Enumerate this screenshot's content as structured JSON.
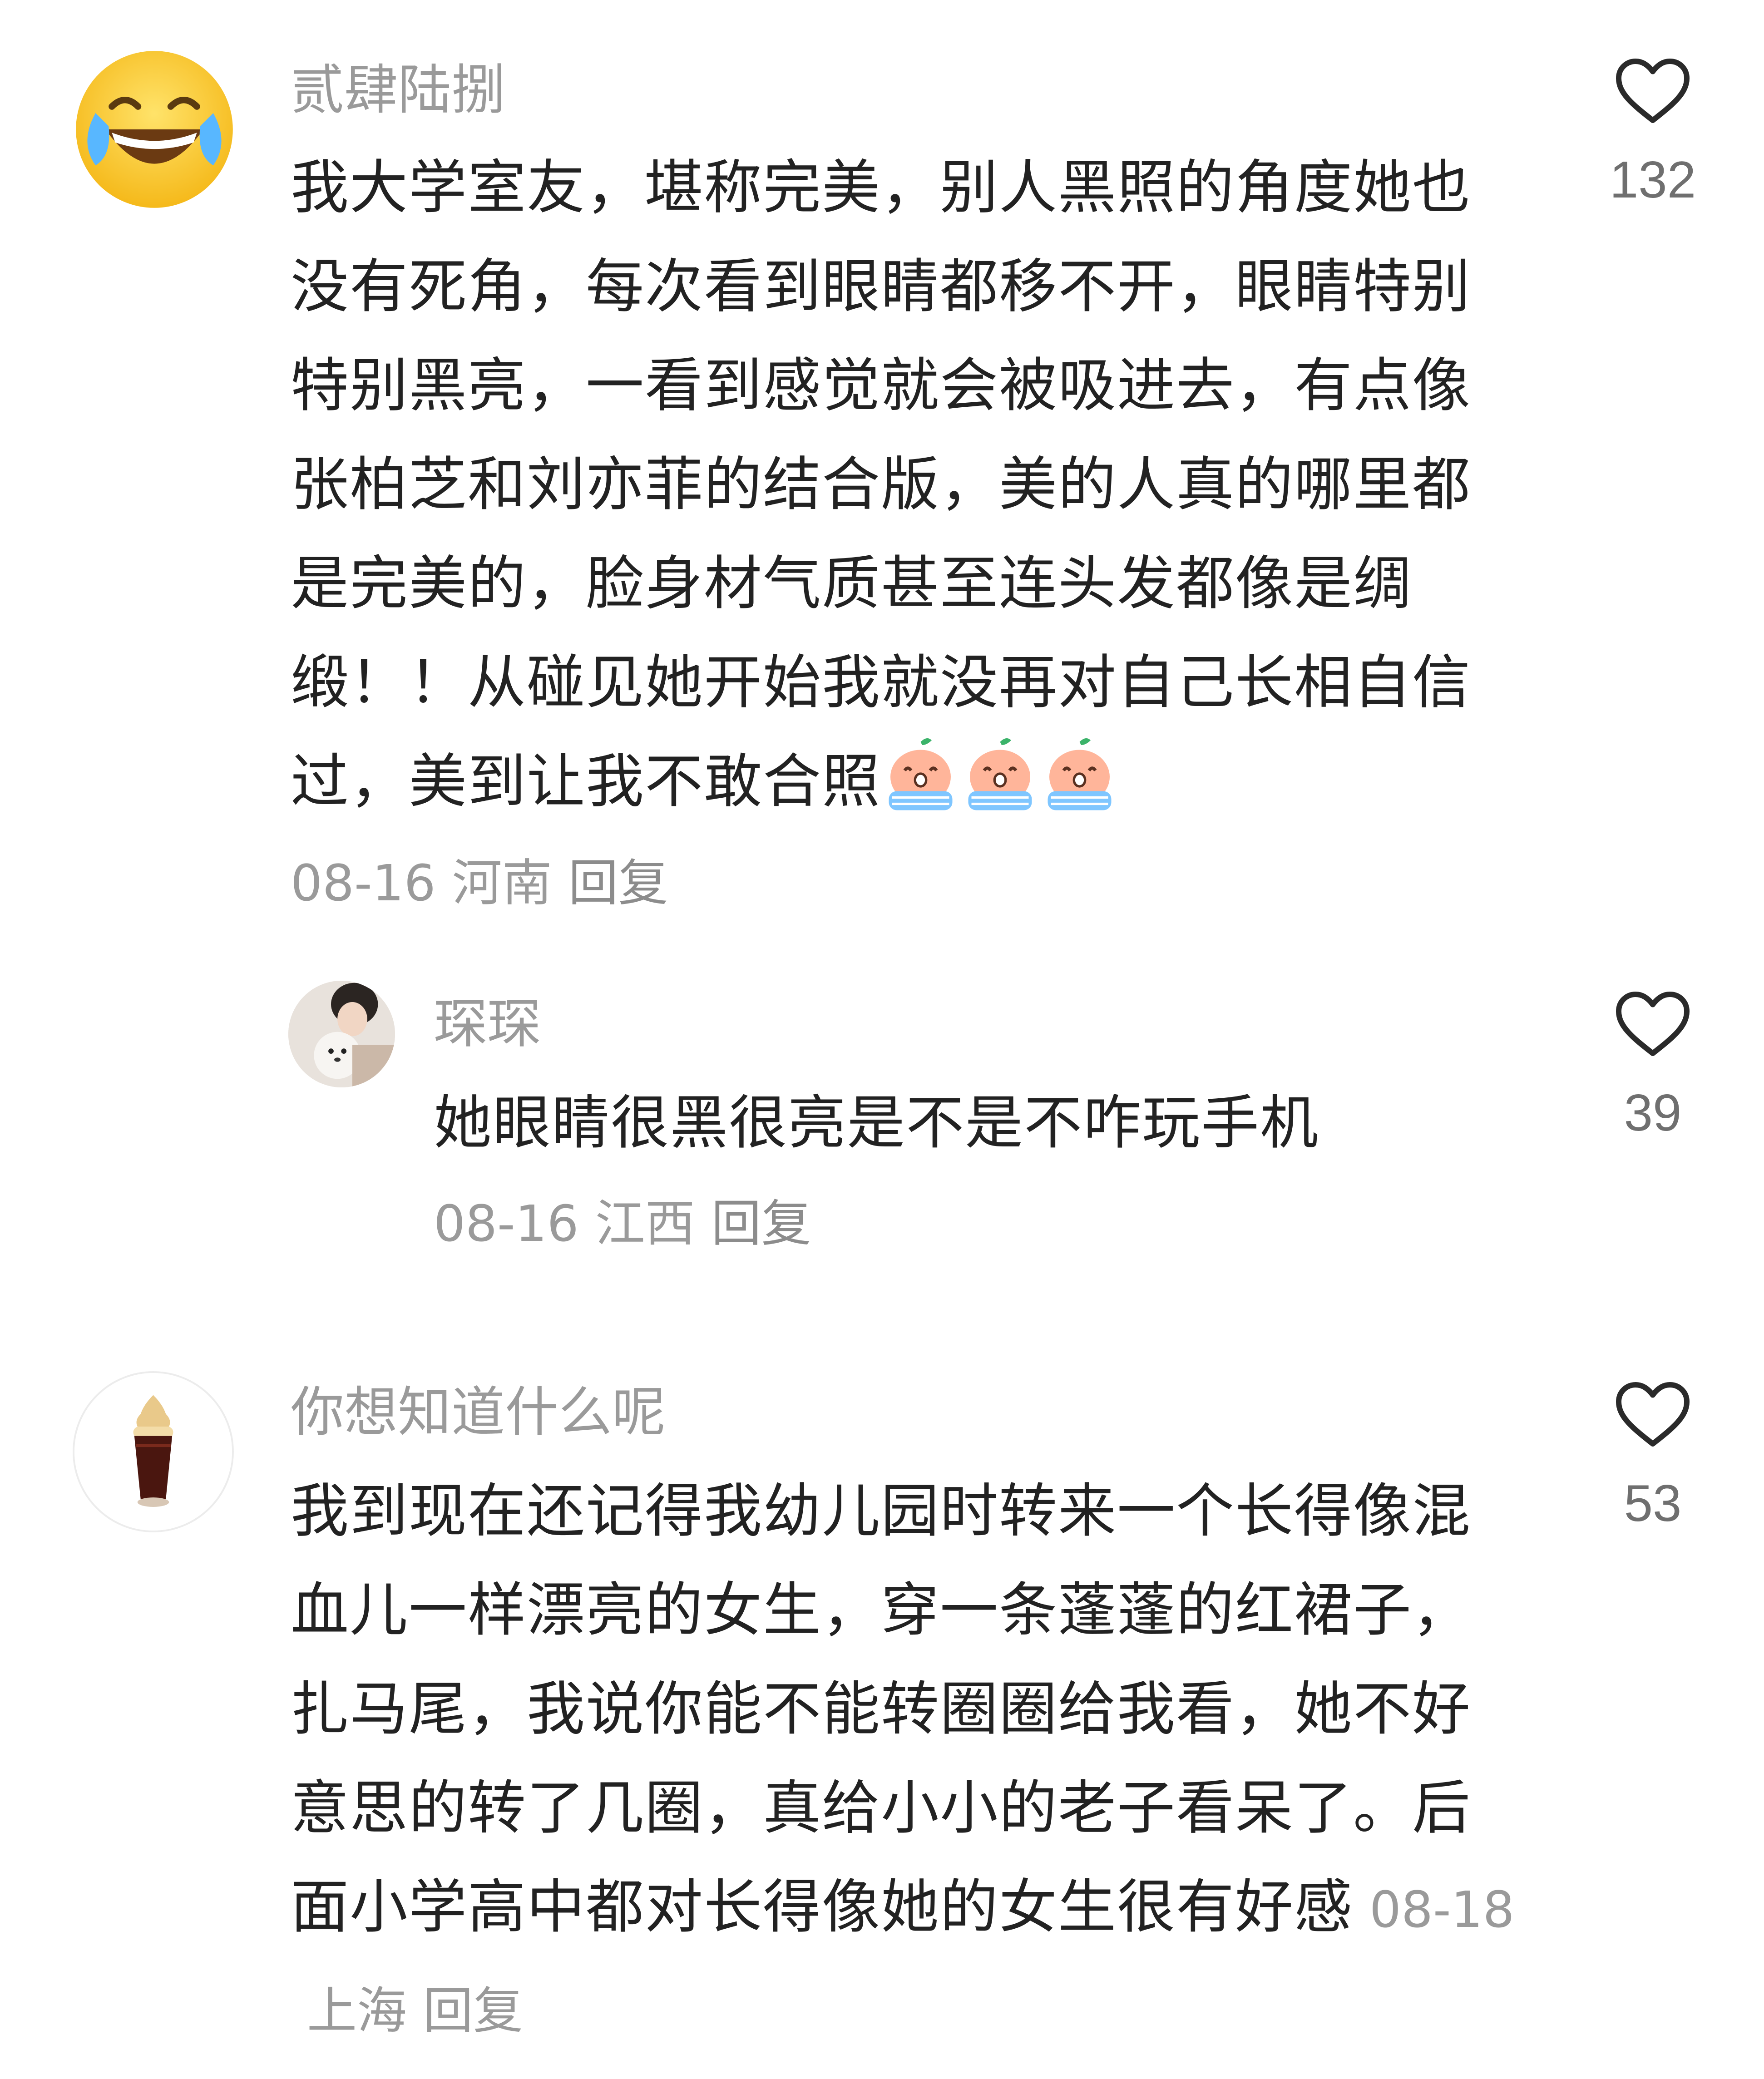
{
  "comments": [
    {
      "username": "贰肆陆捌",
      "avatar_icon": "laughing-tears-emoji-icon",
      "text": "我大学室友，堪称完美，别人黑照的角度她也没有死角，每次看到眼睛都移不开，眼睛特别特别黑亮，一看到感觉就会被吸进去，有点像张柏芝和刘亦菲的结合版，美的人真的哪里都是完美的，脸身材气质甚至连头发都像是绸缎！！从碰见她开始我就没再对自己长相自信过，美到让我不敢合照",
      "emoji_icon": "crying-peach-sticker-icon",
      "date": "08-16",
      "location": "河南",
      "reply_label": "回复",
      "likes": "132",
      "reply": {
        "username": "琛琛",
        "avatar_icon": "person-with-white-dog-avatar",
        "text": "她眼睛很黑很亮是不是不咋玩手机",
        "date": "08-16",
        "location": "江西",
        "reply_label": "回复",
        "likes": "39"
      }
    },
    {
      "username": "你想知道什么呢",
      "avatar_icon": "iced-coffee-float-avatar",
      "text": "我到现在还记得我幼儿园时转来一个长得像混血儿一样漂亮的女生，穿一条蓬蓬的红裙子，扎马尾，我说你能不能转圈圈给我看，她不好意思的转了几圈，真给小小的老子看呆了。后面小学高中都对长得像她的女生很有好感",
      "date": "08-18",
      "location": "上海",
      "reply_label": "回复",
      "likes": "53"
    }
  ],
  "colors": {
    "text": "#222222",
    "muted": "#9a9a9a",
    "count": "#6f6f6f",
    "heart_stroke": "#2a2a2a"
  }
}
